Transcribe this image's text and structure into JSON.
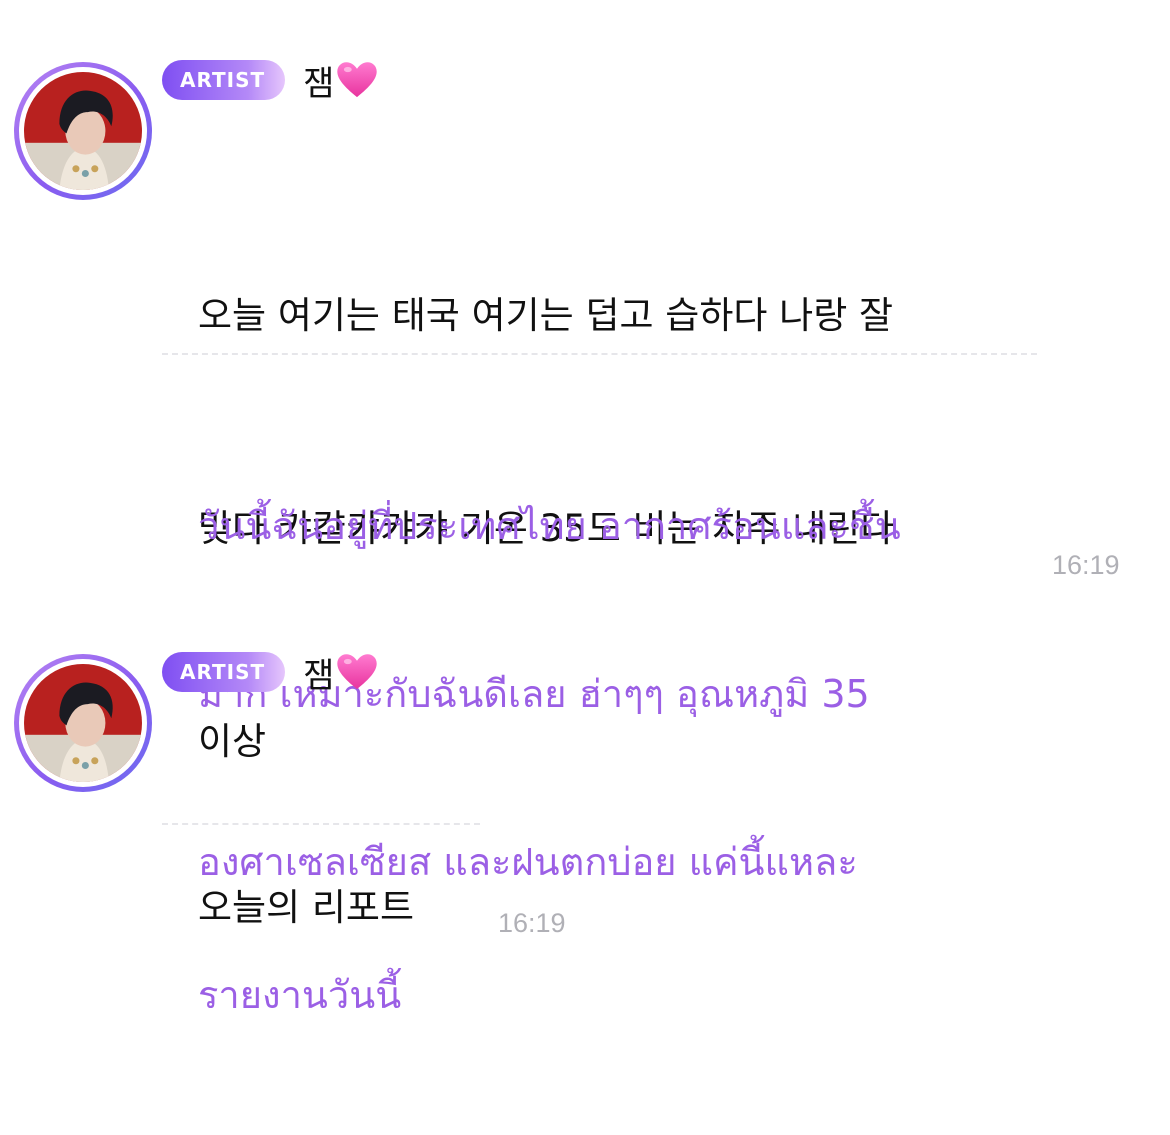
{
  "messages": [
    {
      "badge": "ARTIST",
      "author": "잼",
      "heart_icon": "pink-heart-icon",
      "original_lines": [
        "오늘 여기는 태국 여기는 덥고 습하다 나랑 잘",
        "맞다 캬캳캬캬캬 기온 35도 비는 자주 내린다",
        "이상"
      ],
      "translation_lines": [
        "วันนี้ฉันอยู่ที่ประเทศไทย อากาศร้อนและชื้น",
        "มาก เหมาะกับฉันดีเลย ฮ่าๆๆ อุณหภูมิ 35",
        "องศาเซลเซียส และฝนตกบ่อย แค่นี้แหละ"
      ],
      "time": "16:19"
    },
    {
      "badge": "ARTIST",
      "author": "잼",
      "heart_icon": "pink-heart-icon",
      "original_lines": [
        "오늘의 리포트"
      ],
      "translation_lines": [
        "รายงานวันนี้"
      ],
      "time": "16:19"
    }
  ],
  "colors": {
    "badge_start": "#7f4ff2",
    "badge_end": "#e6c6fc",
    "translation_text": "#9b5fe5",
    "timestamp": "#b0b0b6",
    "heart": "#ff4fb8"
  }
}
